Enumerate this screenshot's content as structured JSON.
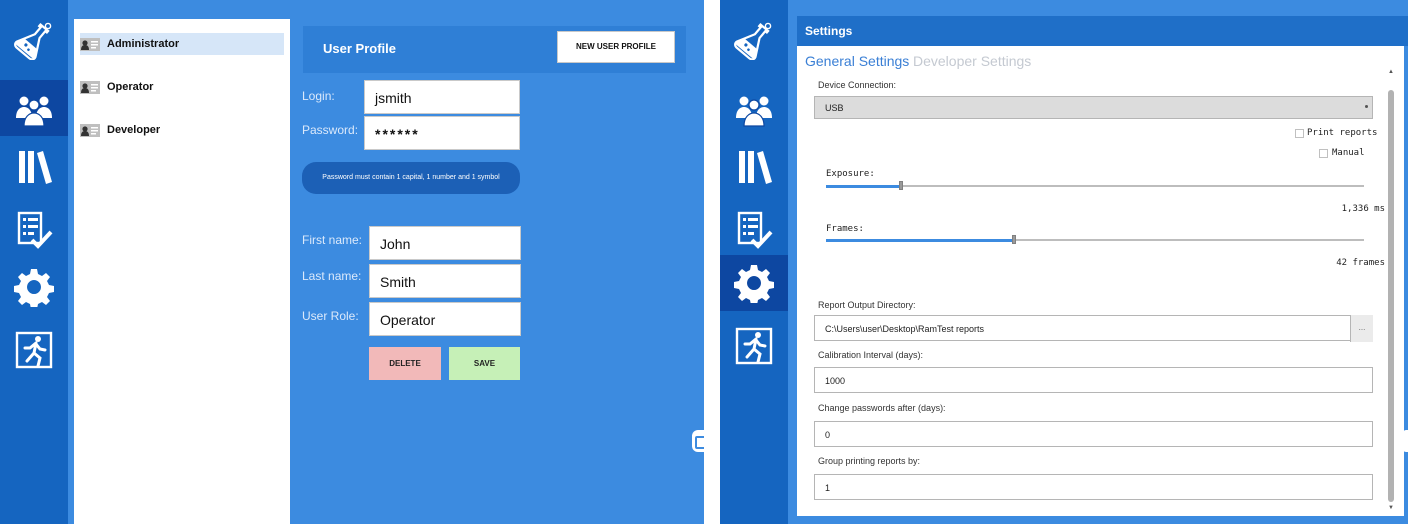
{
  "left_screen": {
    "nav": [
      "flask-icon",
      "users-icon",
      "library-icon",
      "checklist-icon",
      "gear-icon",
      "exit-icon"
    ],
    "active_nav": "users-icon",
    "users": [
      "Administrator",
      "Operator",
      "Developer"
    ],
    "selected_user": "Administrator",
    "profile": {
      "title": "User Profile",
      "new_button": "NEW USER PROFILE",
      "login_label": "Login:",
      "login_value": "jsmith",
      "password_label": "Password:",
      "password_value": "******",
      "password_hint": "Password must contain 1 capital, 1 number and 1 symbol",
      "first_name_label": "First name:",
      "first_name_value": "John",
      "last_name_label": "Last name:",
      "last_name_value": "Smith",
      "role_label": "User Role:",
      "role_value": "Operator",
      "delete_button": "DELETE",
      "save_button": "SAVE"
    }
  },
  "right_screen": {
    "active_nav": "gear-icon",
    "title": "Settings",
    "tabs": {
      "general": "General Settings",
      "developer": "Developer Settings"
    },
    "device_connection_label": "Device Connection:",
    "device_connection_value": "USB",
    "print_reports_label": "Print reports",
    "manual_label": "Manual",
    "exposure_label": "Exposure:",
    "exposure_value": "1,336 ms",
    "exposure_level": 0.14,
    "frames_label": "Frames:",
    "frames_value": "42 frames",
    "frames_level": 0.35,
    "report_dir_label": "Report Output Directory:",
    "report_dir_value": "C:\\Users\\user\\Desktop\\RamTest reports",
    "browse_label": "...",
    "calibration_label": "Calibration Interval (days):",
    "calibration_value": "1000",
    "change_pw_label": "Change passwords after (days):",
    "change_pw_value": "0",
    "group_print_label": "Group printing reports by:",
    "group_print_value": "1"
  },
  "colors": {
    "background_blue": "#3c8be0",
    "nav_blue": "#1565c0",
    "delete_button": "#f2b9b9",
    "save_button": "#c6f0b7"
  }
}
